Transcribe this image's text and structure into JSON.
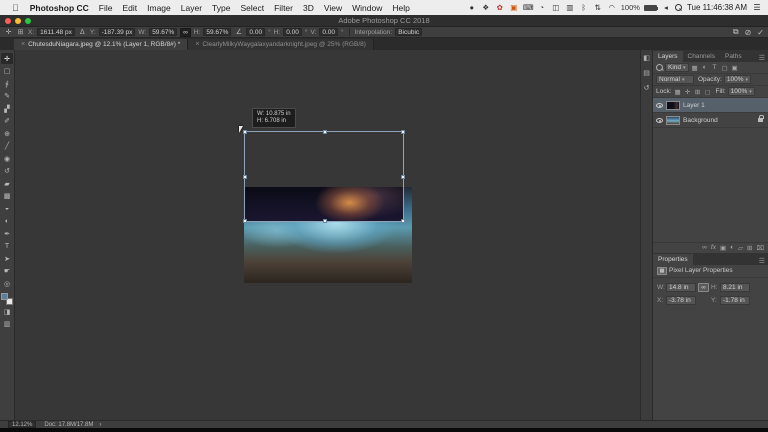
{
  "menubar": {
    "apple": "",
    "items": [
      "Photoshop CC",
      "File",
      "Edit",
      "Image",
      "Layer",
      "Type",
      "Select",
      "Filter",
      "3D",
      "View",
      "Window",
      "Help"
    ],
    "icons": [
      {
        "name": "dot-icon",
        "glyph": "●"
      },
      {
        "name": "shield-icon",
        "glyph": "❖"
      },
      {
        "name": "red-app-icon",
        "glyph": "✿"
      },
      {
        "name": "orange-app-icon",
        "glyph": "▣"
      },
      {
        "name": "keyboard-icon",
        "glyph": "⌨"
      },
      {
        "name": "time-machine-icon",
        "glyph": "◔"
      },
      {
        "name": "phone-icon",
        "glyph": "◫"
      },
      {
        "name": "display-icon",
        "glyph": "▥"
      },
      {
        "name": "bluetooth-icon",
        "glyph": "ᛒ"
      },
      {
        "name": "updown-arrows-icon",
        "glyph": "⇅"
      },
      {
        "name": "wifi-icon",
        "glyph": "◠"
      }
    ],
    "battery_label": "100%",
    "volume_glyph": "◂",
    "clock": "Tue 11:46:38 AM",
    "list_menu_glyph": "☰"
  },
  "titlebar": {
    "title": "Adobe Photoshop CC 2018"
  },
  "options_bar": {
    "tool_icon_glyph": "✛",
    "reference_point_glyph": "⊞",
    "x_label": "X:",
    "x_value": "1611.48 px",
    "delta_glyph": "Δ",
    "y_label": "Y:",
    "y_value": "-187.39 px",
    "w_label": "W:",
    "w_value": "59.67%",
    "link_glyph": "∞",
    "h_label": "H:",
    "h_value": "59.67%",
    "angle_glyph": "∠",
    "angle_value": "0.00",
    "deg": "°",
    "hskew_label": "H:",
    "hskew_value": "0.00",
    "vskew_label": "V:",
    "vskew_value": "0.00",
    "interp_label": "Interpolation:",
    "interp_value": "Bicubic",
    "warp_glyph": "⧉",
    "cancel_glyph": "⊘",
    "commit_glyph": "✓"
  },
  "tabs": [
    {
      "close": "×",
      "label": "ChutesduNiagara.jpeg @ 12.1% (Layer 1, RGB/8#) *"
    },
    {
      "close": "×",
      "label": "ClearlyMilkyWaygalaxyandarknight.jpeg @ 25% (RGB/8)"
    }
  ],
  "tools": [
    {
      "name": "move-tool",
      "glyph": "✛"
    },
    {
      "name": "marquee-tool",
      "glyph": "▢"
    },
    {
      "name": "lasso-tool",
      "glyph": "∮"
    },
    {
      "name": "quick-selection-tool",
      "glyph": "✎"
    },
    {
      "name": "crop-tool",
      "glyph": "▞"
    },
    {
      "name": "eyedropper-tool",
      "glyph": "✐"
    },
    {
      "name": "healing-brush-tool",
      "glyph": "⊕"
    },
    {
      "name": "brush-tool",
      "glyph": "╱"
    },
    {
      "name": "clone-stamp-tool",
      "glyph": "◉"
    },
    {
      "name": "history-brush-tool",
      "glyph": "↺"
    },
    {
      "name": "eraser-tool",
      "glyph": "▰"
    },
    {
      "name": "gradient-tool",
      "glyph": "▩"
    },
    {
      "name": "blur-tool",
      "glyph": "◒"
    },
    {
      "name": "dodge-tool",
      "glyph": "◐"
    },
    {
      "name": "pen-tool",
      "glyph": "✒"
    },
    {
      "name": "type-tool",
      "glyph": "T"
    },
    {
      "name": "path-selection-tool",
      "glyph": "➤"
    },
    {
      "name": "hand-tool",
      "glyph": "☛"
    },
    {
      "name": "zoom-tool",
      "glyph": "◎"
    }
  ],
  "toolbar_bottom": {
    "quick_mask_glyph": "◨",
    "screen_mode_glyph": "▥"
  },
  "canvas": {
    "tooltip": {
      "w": "W: 10.875 in",
      "h": "H: 6.708 in"
    }
  },
  "panel_strip": [
    {
      "name": "color-panel-icon",
      "glyph": "◧"
    },
    {
      "name": "libraries-panel-icon",
      "glyph": "▤"
    },
    {
      "name": "history-panel-icon",
      "glyph": "↺"
    }
  ],
  "layers_panel": {
    "tabs": [
      "Layers",
      "Channels",
      "Paths"
    ],
    "menu_glyph": "☰",
    "filter_label": "Kind",
    "filter_icons": [
      {
        "name": "pixel-filter-icon",
        "glyph": "▦"
      },
      {
        "name": "adjustment-filter-icon",
        "glyph": "◐"
      },
      {
        "name": "type-filter-icon",
        "glyph": "T"
      },
      {
        "name": "shape-filter-icon",
        "glyph": "▢"
      },
      {
        "name": "smart-object-filter-icon",
        "glyph": "▣"
      }
    ],
    "blend_mode": "Normal",
    "opacity_label": "Opacity:",
    "opacity_value": "100%",
    "lock_label": "Lock:",
    "lock_icons": [
      {
        "name": "lock-transparency-icon",
        "glyph": "▦"
      },
      {
        "name": "lock-pixels-icon",
        "glyph": "✛"
      },
      {
        "name": "lock-position-icon",
        "glyph": "⊞"
      },
      {
        "name": "lock-all-icon",
        "glyph": "◻"
      }
    ],
    "fill_label": "Fill:",
    "fill_value": "100%",
    "layers": [
      {
        "name": "Layer 1"
      },
      {
        "name": "Background"
      }
    ],
    "bottom_icons": [
      {
        "name": "link-layers-icon",
        "glyph": "∞"
      },
      {
        "name": "layer-effects-icon",
        "glyph": "fx"
      },
      {
        "name": "layer-mask-icon",
        "glyph": "▣"
      },
      {
        "name": "adjustment-layer-icon",
        "glyph": "◐"
      },
      {
        "name": "layer-group-icon",
        "glyph": "▱"
      },
      {
        "name": "new-layer-icon",
        "glyph": "⊞"
      },
      {
        "name": "delete-layer-icon",
        "glyph": "⌧"
      }
    ]
  },
  "properties_panel": {
    "tab": "Properties",
    "menu_glyph": "☰",
    "thumb_glyph": "▦",
    "subtitle": "Pixel Layer Properties",
    "w_label": "W:",
    "w_value": "14.8 in",
    "link_glyph": "∞",
    "h_label": "H:",
    "h_value": "8.21 in",
    "x_label": "X:",
    "x_value": "-3.78 in",
    "y_label": "Y:",
    "y_value": "-1.78 in"
  },
  "statusbar": {
    "zoom": "12.12%",
    "doc": "Doc: 17.8M/17.8M",
    "chevron": "›"
  }
}
